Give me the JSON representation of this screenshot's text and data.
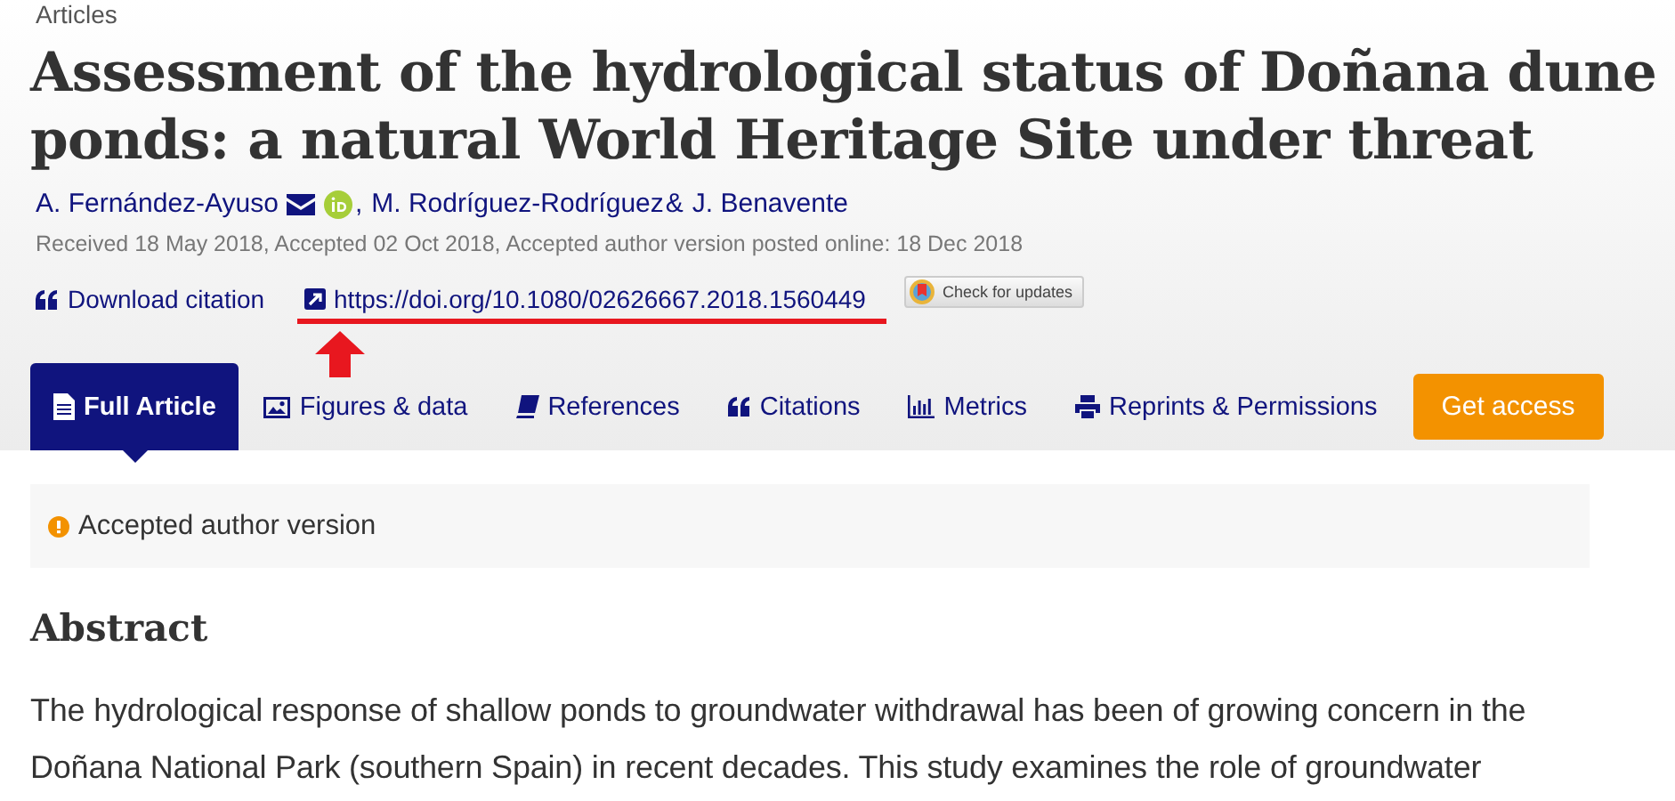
{
  "breadcrumb": "Articles",
  "title": "Assessment of the hydrological status of Doñana dune ponds: a natural World Heritage Site under threat",
  "authors": [
    {
      "name": "A. Fernández-Ayuso",
      "email": true,
      "orcid": true,
      "after": ","
    },
    {
      "name": "M. Rodríguez-Rodríguez",
      "email": false,
      "orcid": false,
      "after": "&"
    },
    {
      "name": "J. Benavente",
      "email": false,
      "orcid": false
    }
  ],
  "history": "Received 18 May 2018, Accepted 02 Oct 2018, Accepted author version posted online: 18 Dec 2018",
  "download_citation": "Download citation",
  "doi": "https://doi.org/10.1080/02626667.2018.1560449",
  "check_updates": "Check for updates",
  "tabs": [
    {
      "label": "Full Article",
      "selected": true
    },
    {
      "label": "Figures & data",
      "selected": false
    },
    {
      "label": "References",
      "selected": false
    },
    {
      "label": "Citations",
      "selected": false
    },
    {
      "label": "Metrics",
      "selected": false
    },
    {
      "label": "Reprints & Permissions",
      "selected": false
    }
  ],
  "get_access": "Get access",
  "notice": "Accepted author version",
  "abstract": {
    "heading": "Abstract",
    "text": "The hydrological response of shallow ponds to groundwater withdrawal has been of growing concern in the Doñana National Park (southern Spain) in recent decades. This study examines the role of groundwater"
  }
}
